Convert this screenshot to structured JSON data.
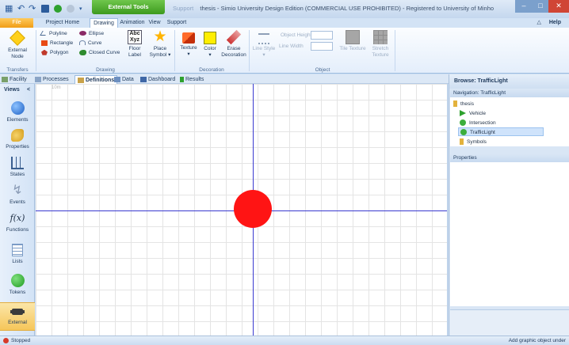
{
  "titlebar": {
    "context_tab": "External Tools",
    "support_tab": "Support",
    "title": "thesis - Simio University Design Edition (COMMERCIAL USE PROHIBITED) - Registered to University of Minho",
    "minimize": "–",
    "maximize": "□",
    "close": "✕"
  },
  "ribbon_tabs": {
    "file": "File",
    "project_home": "Project Home",
    "drawing": "Drawing",
    "animation": "Animation",
    "view": "View",
    "support": "Support",
    "help": "Help"
  },
  "ribbon": {
    "transfers": {
      "external_node": "External Node",
      "group": "Transfers"
    },
    "drawing": {
      "polyline": "Polyline",
      "rectangle": "Rectangle",
      "polygon": "Polygon",
      "ellipse": "Ellipse",
      "curve": "Curve",
      "closed_curve": "Closed Curve",
      "floor_label": "Floor Label",
      "place_symbol": "Place Symbol",
      "group": "Drawing"
    },
    "decoration": {
      "texture": "Texture",
      "color": "Color",
      "erase_decoration": "Erase Decoration",
      "group": "Decoration"
    },
    "object": {
      "line_style": "Line Style",
      "object_height": "Object Height",
      "line_width": "Line Width",
      "tile_texture": "Tile Texture",
      "stretch_texture": "Stretch Texture",
      "group": "Object"
    },
    "colors": {
      "accent_green": "#3d9a1e",
      "file_orange": "#f09d16",
      "color_swatch": "#ffee00"
    }
  },
  "doc_tabs": [
    "Facility",
    "Processes",
    "Definitions",
    "Data",
    "Dashboard",
    "Results"
  ],
  "views": {
    "header": "Views",
    "collapse": "<",
    "items": [
      "Elements",
      "Properties",
      "States",
      "Events",
      "Functions",
      "Lists",
      "Tokens",
      "External"
    ],
    "function_glyph": "f(x)"
  },
  "canvas": {
    "scale_label": "10m",
    "light_color": "#ff1414",
    "axis_color": "#3a3ad0"
  },
  "browse": {
    "header": "Browse: TrafficLight",
    "navigation_header": "Navigation: TrafficLight",
    "tree": [
      "thesis",
      "Vehicle",
      "Intersection",
      "TrafficLight",
      "Symbols"
    ],
    "properties_header": "Properties"
  },
  "status": {
    "left": "Stopped",
    "right": "Add graphic object under"
  }
}
